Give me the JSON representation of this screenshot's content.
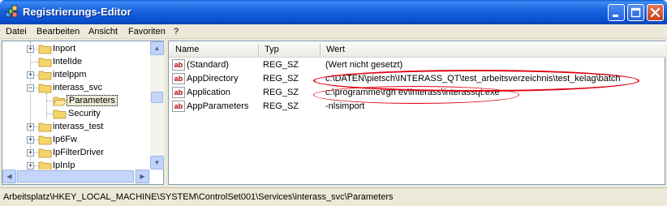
{
  "window": {
    "title": "Registrierungs-Editor",
    "icon": "registry-editor-icon",
    "controls": {
      "minimize": "minimize-icon",
      "maximize": "maximize-icon",
      "close": "close-icon"
    }
  },
  "menu": [
    {
      "label": "Datei"
    },
    {
      "label": "Bearbeiten"
    },
    {
      "label": "Ansicht"
    },
    {
      "label": "Favoriten"
    },
    {
      "label": "?"
    }
  ],
  "tree": {
    "items": [
      {
        "label": "Inport",
        "expanded": false,
        "has_children": true
      },
      {
        "label": "IntelIde",
        "expanded": false,
        "has_children": false
      },
      {
        "label": "intelppm",
        "expanded": false,
        "has_children": true
      },
      {
        "label": "interass_svc",
        "expanded": true,
        "has_children": true
      },
      {
        "label": "Parameters",
        "selected": true,
        "open_folder": true
      },
      {
        "label": "Security"
      },
      {
        "label": "interass_test",
        "expanded": false,
        "has_children": true
      },
      {
        "label": "Ip6Fw",
        "expanded": false,
        "has_children": true
      },
      {
        "label": "IpFilterDriver",
        "expanded": false,
        "has_children": true
      },
      {
        "label": "IpInIp",
        "expanded": false,
        "has_children": true
      }
    ]
  },
  "list": {
    "columns": {
      "name": "Name",
      "type": "Typ",
      "value": "Wert"
    },
    "rows": [
      {
        "name": "(Standard)",
        "type": "REG_SZ",
        "value": "(Wert nicht gesetzt)"
      },
      {
        "name": "AppDirectory",
        "type": "REG_SZ",
        "value": "c:\\DATEN\\pietsch\\INTERASS_QT\\test_arbeitsverzeichnis\\test_kelag\\batch"
      },
      {
        "name": "Application",
        "type": "REG_SZ",
        "value": "c:\\programme\\rgh ev\\interass\\interassqt.exe"
      },
      {
        "name": "AppParameters",
        "type": "REG_SZ",
        "value": "-nlsimport"
      }
    ]
  },
  "status": {
    "path": "Arbeitsplatz\\HKEY_LOCAL_MACHINE\\SYSTEM\\ControlSet001\\Services\\interass_svc\\Parameters"
  },
  "colors": {
    "highlight_ellipse": "#e00010",
    "titlebar": "#0a4fd0",
    "folder": "#f5d56a"
  }
}
